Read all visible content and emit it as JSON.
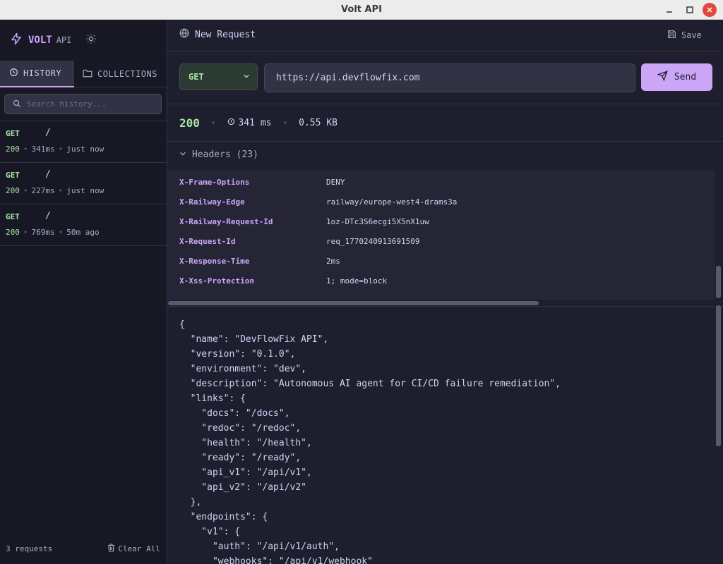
{
  "window": {
    "title": "Volt API"
  },
  "colors": {
    "accent": "#cba6f7",
    "success": "#a6e3a1",
    "background": "#1e1e2e",
    "sidebar": "#181825"
  },
  "sidebar": {
    "brand": "VOLT",
    "brand_suffix": "API",
    "tabs": [
      {
        "label": "HISTORY",
        "icon": "clock-icon",
        "active": true
      },
      {
        "label": "COLLECTIONS",
        "icon": "folder-icon",
        "active": false
      }
    ],
    "search_placeholder": "Search history...",
    "history": [
      {
        "method": "GET",
        "path": "/",
        "status": "200",
        "duration": "341ms",
        "when": "just now"
      },
      {
        "method": "GET",
        "path": "/",
        "status": "200",
        "duration": "227ms",
        "when": "just now"
      },
      {
        "method": "GET",
        "path": "/",
        "status": "200",
        "duration": "769ms",
        "when": "50m ago"
      }
    ],
    "footer_count": "3 requests",
    "clear_label": "Clear All"
  },
  "request": {
    "title": "New Request",
    "save_label": "Save",
    "method": "GET",
    "url": "https://api.devflowfix.com",
    "send_label": "Send"
  },
  "response": {
    "status": "200",
    "time": "341 ms",
    "size": "0.55 KB",
    "headers_label": "Headers (23)",
    "headers": [
      {
        "key": "X-Frame-Options",
        "value": "DENY"
      },
      {
        "key": "X-Railway-Edge",
        "value": "railway/europe-west4-drams3a"
      },
      {
        "key": "X-Railway-Request-Id",
        "value": "1oz-DTc3S6ecgi5X5nX1uw"
      },
      {
        "key": "X-Request-Id",
        "value": "req_1770240913691509"
      },
      {
        "key": "X-Response-Time",
        "value": "2ms"
      },
      {
        "key": "X-Xss-Protection",
        "value": "1; mode=block"
      }
    ],
    "body": "{\n  \"name\": \"DevFlowFix API\",\n  \"version\": \"0.1.0\",\n  \"environment\": \"dev\",\n  \"description\": \"Autonomous AI agent for CI/CD failure remediation\",\n  \"links\": {\n    \"docs\": \"/docs\",\n    \"redoc\": \"/redoc\",\n    \"health\": \"/health\",\n    \"ready\": \"/ready\",\n    \"api_v1\": \"/api/v1\",\n    \"api_v2\": \"/api/v2\"\n  },\n  \"endpoints\": {\n    \"v1\": {\n      \"auth\": \"/api/v1/auth\",\n      \"webhooks\": \"/api/v1/webhook\""
  }
}
